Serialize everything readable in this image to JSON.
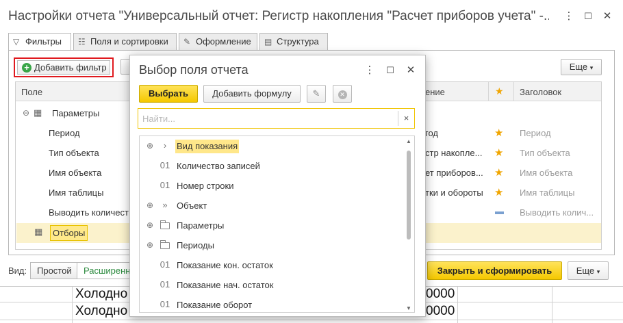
{
  "window": {
    "title": "Настройки отчета \"Универсальный отчет: Регистр накопления \"Расчет приборов учета\" -...",
    "more_icon": "⋮",
    "maximize_icon": "☐",
    "close_icon": "✕"
  },
  "tabs": [
    {
      "label": "Фильтры",
      "icon": "filter-icon",
      "active": true
    },
    {
      "label": "Поля и сортировки",
      "icon": "fields-icon",
      "active": false
    },
    {
      "label": "Оформление",
      "icon": "brush-icon",
      "active": false
    },
    {
      "label": "Структура",
      "icon": "structure-icon",
      "active": false
    }
  ],
  "toolbar": {
    "add_filter_label": "Добавить фильтр",
    "more_label": "Еще"
  },
  "grid": {
    "columns": {
      "field": "Поле",
      "value": "ение",
      "heading": "Заголовок"
    },
    "group_label": "Параметры",
    "rows": [
      {
        "field": "Период",
        "value": "год",
        "heading": "Период",
        "star": true
      },
      {
        "field": "Тип объекта",
        "value": "стр накопле...",
        "heading": "Тип объекта",
        "star": true
      },
      {
        "field": "Имя объекта",
        "value": "ет приборов...",
        "heading": "Имя объекта",
        "star": true
      },
      {
        "field": "Имя таблицы",
        "value": "тки и обороты",
        "heading": "Имя таблицы",
        "star": true
      },
      {
        "field": "Выводить количест",
        "value": "",
        "heading": "Выводить колич...",
        "star": false
      }
    ],
    "selected_group": "Отборы"
  },
  "bottom": {
    "vid_label": "Вид:",
    "simple_label": "Простой",
    "extended_label": "Расширенн",
    "close_generate_label": "Закрыть и сформировать",
    "more_label": "Еще"
  },
  "background_sheet": {
    "row1_text": "Холодно",
    "row2_text": "Холодно",
    "value1": "0000",
    "value2": "0000"
  },
  "modal": {
    "title": "Выбор поля отчета",
    "select_label": "Выбрать",
    "add_formula_label": "Добавить формулу",
    "search_placeholder": "Найти...",
    "clear_icon": "×",
    "items": [
      {
        "label": "Вид показания",
        "expand": "⊕",
        "icon": "chevron-right-icon",
        "glyph": ">",
        "selected": true
      },
      {
        "label": "Количество записей",
        "expand": "",
        "icon": "number-icon",
        "glyph": "01",
        "selected": false
      },
      {
        "label": "Номер строки",
        "expand": "",
        "icon": "number-icon",
        "glyph": "01",
        "selected": false
      },
      {
        "label": "Объект",
        "expand": "⊕",
        "icon": "double-chevron-icon",
        "glyph": ">>",
        "selected": false
      },
      {
        "label": "Параметры",
        "expand": "⊕",
        "icon": "folder-icon",
        "glyph": "",
        "selected": false
      },
      {
        "label": "Периоды",
        "expand": "⊕",
        "icon": "folder-icon",
        "glyph": "",
        "selected": false
      },
      {
        "label": "Показание кон. остаток",
        "expand": "",
        "icon": "number-icon",
        "glyph": "01",
        "selected": false
      },
      {
        "label": "Показание нач. остаток",
        "expand": "",
        "icon": "number-icon",
        "glyph": "01",
        "selected": false
      },
      {
        "label": "Показание оборот",
        "expand": "",
        "icon": "number-icon",
        "glyph": "01",
        "selected": false
      }
    ]
  },
  "colors": {
    "accent_yellow": "#f5c800",
    "star": "#f0a500",
    "highlight_red": "#e0191e",
    "selection": "#ffe78a",
    "green_link": "#2b8a3e"
  }
}
